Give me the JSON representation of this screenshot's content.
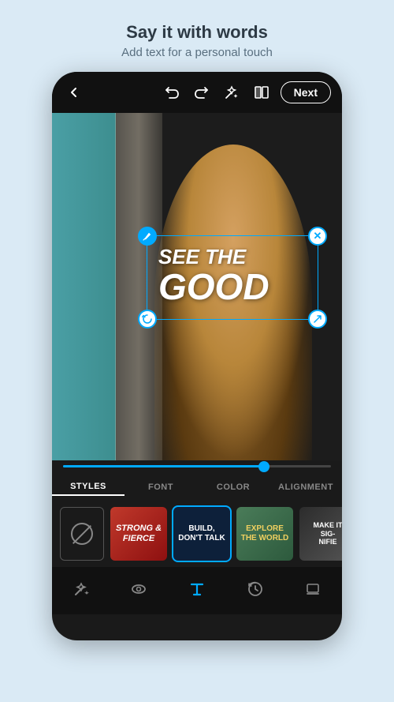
{
  "header": {
    "title": "Say it with words",
    "subtitle": "Add text for a personal touch"
  },
  "topbar": {
    "next_label": "Next",
    "back_icon": "back-arrow",
    "undo_icon": "undo",
    "redo_icon": "redo",
    "edit_icon": "edit-wand",
    "compare_icon": "compare"
  },
  "text_overlay": {
    "line1": "SEE THE",
    "line2": "GOOD"
  },
  "style_tabs": [
    {
      "label": "STYLES",
      "active": true
    },
    {
      "label": "FONT",
      "active": false
    },
    {
      "label": "COLOR",
      "active": false
    },
    {
      "label": "ALIGNMENT",
      "active": false
    }
  ],
  "style_cards": [
    {
      "id": "none",
      "type": "none"
    },
    {
      "id": "strong",
      "label": "STRONG &\nFIERCE",
      "selected": false
    },
    {
      "id": "build",
      "label": "BUILD,\nDON'T TALK",
      "selected": true
    },
    {
      "id": "explore",
      "label": "EXPLORE\nTHE WORLD",
      "selected": false
    },
    {
      "id": "make",
      "label": "MAKE IT\nSIG-\nNIFIE",
      "selected": false
    }
  ],
  "bottom_nav": [
    {
      "icon": "magic-wand",
      "active": false
    },
    {
      "icon": "eye",
      "active": false
    },
    {
      "icon": "text-T",
      "active": true
    },
    {
      "icon": "history",
      "active": false
    },
    {
      "icon": "layers",
      "active": false
    }
  ],
  "slider": {
    "value": 75,
    "min": 0,
    "max": 100
  }
}
